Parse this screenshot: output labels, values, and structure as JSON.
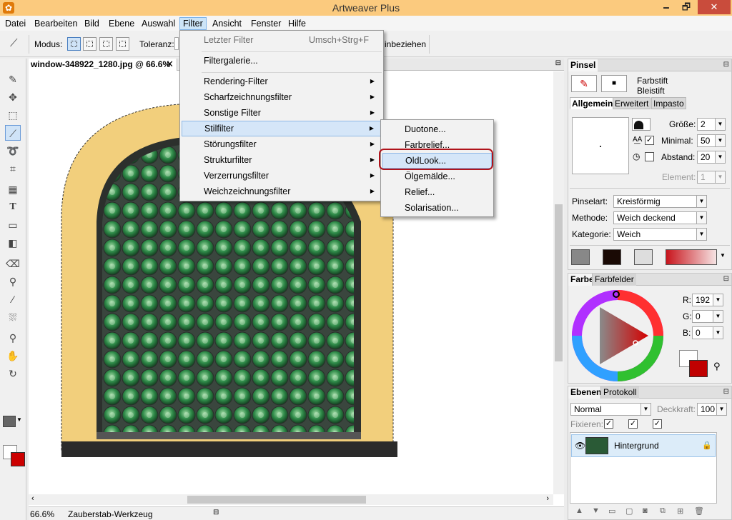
{
  "window": {
    "title": "Artweaver Plus",
    "minimize": "🗕",
    "maximize": "🗗",
    "close": "✕"
  },
  "menubar": [
    "Datei",
    "Bearbeiten",
    "Bild",
    "Ebene",
    "Auswahl",
    "Filter",
    "Ansicht",
    "Fenster",
    "Hilfe"
  ],
  "options_bar": {
    "mode_label": "Modus:",
    "tolerance_label": "Toleranz:",
    "include_label": "inbeziehen"
  },
  "document": {
    "tab_title": "window-348922_1280.jpg @ 66.6%",
    "close": "✕"
  },
  "status": {
    "zoom": "66.6%",
    "tool": "Zauberstab-Werkzeug"
  },
  "filter_menu": {
    "last_filter": "Letzter Filter",
    "last_filter_shortcut": "Umsch+Strg+F",
    "gallery": "Filtergalerie...",
    "items": [
      "Rendering-Filter",
      "Scharfzeichnungsfilter",
      "Sonstige Filter",
      "Stilfilter",
      "Störungsfilter",
      "Strukturfilter",
      "Verzerrungsfilter",
      "Weichzeichnungsfilter"
    ],
    "highlighted": "Stilfilter"
  },
  "stil_submenu": {
    "items": [
      "Duotone...",
      "Farbrelief...",
      "OldLook...",
      "Ölgemälde...",
      "Relief...",
      "Solarisation..."
    ],
    "highlighted": "OldLook..."
  },
  "brush_panel": {
    "title": "Pinsel",
    "brush_name": "Farbstift",
    "brush_variant": "Bleistift",
    "tabs": [
      "Allgemein",
      "Erweitert",
      "Impasto"
    ],
    "size_label": "Größe:",
    "size_value": "2",
    "minimal_label": "Minimal:",
    "minimal_value": "50",
    "spacing_label": "Abstand:",
    "spacing_value": "20",
    "element_label": "Element:",
    "element_value": "1",
    "brushtype_label": "Pinselart:",
    "brushtype_value": "Kreisförmig",
    "method_label": "Methode:",
    "method_value": "Weich deckend",
    "category_label": "Kategorie:",
    "category_value": "Weich"
  },
  "color_panel": {
    "tabs": [
      "Farbe",
      "Farbfelder"
    ],
    "r_label": "R:",
    "r_value": "192",
    "g_label": "G:",
    "g_value": "0",
    "b_label": "B:",
    "b_value": "0",
    "foreground": "#c00000",
    "background": "#ffffff"
  },
  "layers_panel": {
    "tabs": [
      "Ebenen",
      "Protokoll"
    ],
    "blend_mode": "Normal",
    "opacity_label": "Deckkraft:",
    "opacity_value": "100",
    "lock_label": "Fixieren:",
    "layer_name": "Hintergrund"
  },
  "colors": {
    "accent": "#cfe3f7",
    "highlight_ring": "#b0141c",
    "titlebar": "#fbca7e",
    "fg_color": "#c00000"
  }
}
